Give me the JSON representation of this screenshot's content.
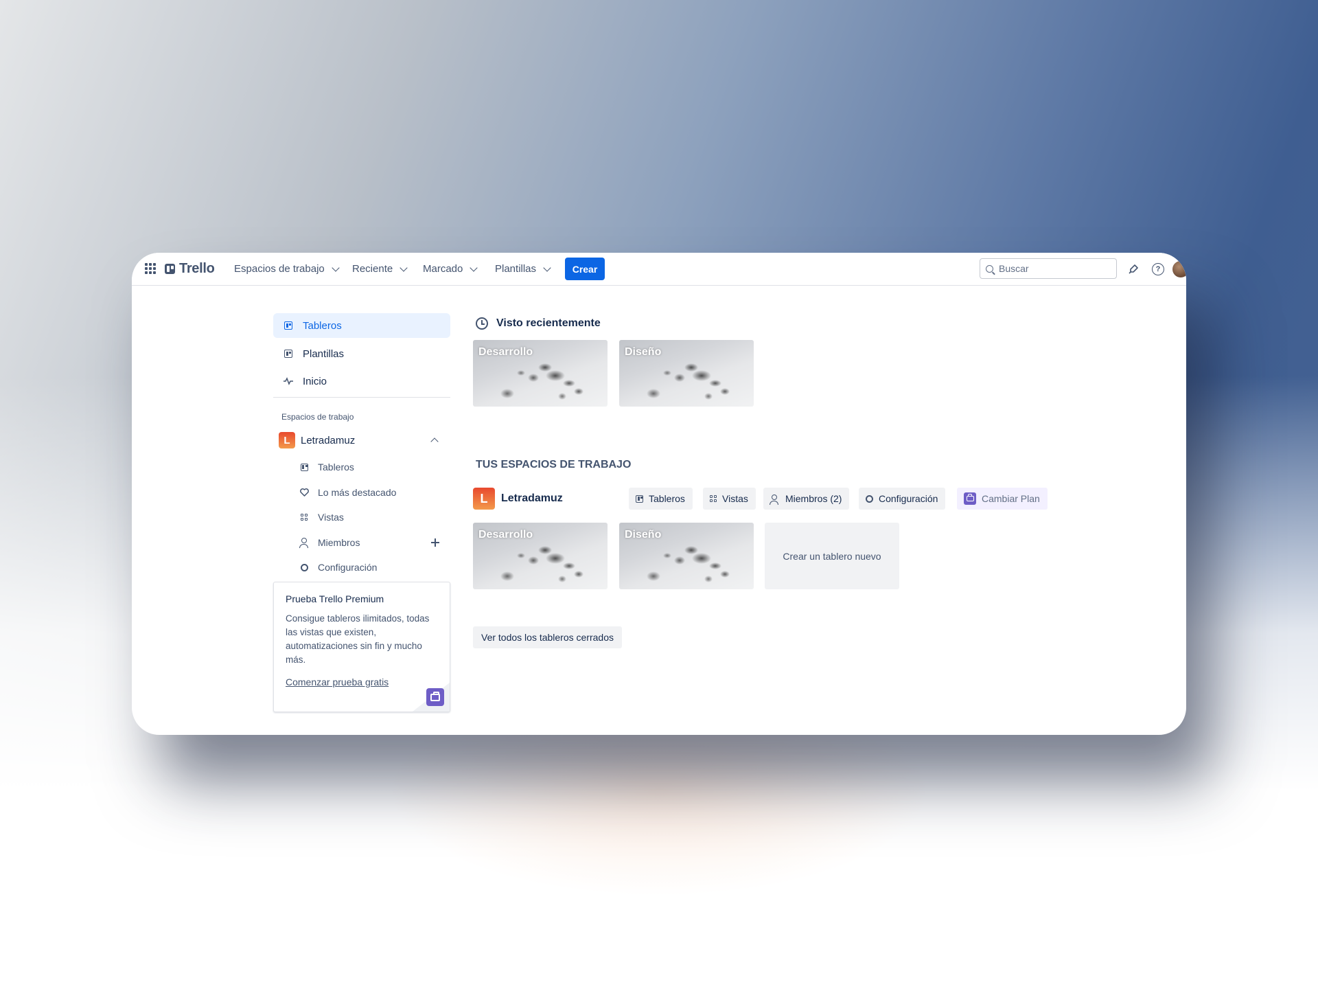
{
  "header": {
    "logo": "Trello",
    "nav": [
      {
        "label": "Espacios de trabajo"
      },
      {
        "label": "Reciente"
      },
      {
        "label": "Marcado"
      },
      {
        "label": "Plantillas"
      }
    ],
    "create_label": "Crear",
    "search_placeholder": "Buscar",
    "icons": [
      "apps-grid-icon",
      "rocket-notification-icon",
      "help-icon",
      "avatar"
    ]
  },
  "sidebar": {
    "items": [
      {
        "label": "Tableros",
        "icon": "board-icon",
        "active": true
      },
      {
        "label": "Plantillas",
        "icon": "template-icon"
      },
      {
        "label": "Inicio",
        "icon": "activity-icon"
      }
    ],
    "workspaces_label": "Espacios de trabajo",
    "workspace": {
      "initial": "L",
      "name": "Letradamuz",
      "subitems": [
        {
          "label": "Tableros",
          "icon": "board-icon"
        },
        {
          "label": "Lo más destacado",
          "icon": "heart-icon"
        },
        {
          "label": "Vistas",
          "icon": "grid-icon"
        },
        {
          "label": "Miembros",
          "icon": "members-icon"
        },
        {
          "label": "Configuración",
          "icon": "gear-icon"
        }
      ]
    },
    "promo": {
      "title": "Prueba Trello Premium",
      "body": "Consigue tableros ilimitados, todas las vistas que existen, automatizaciones sin fin y mucho más.",
      "link": "Comenzar prueba gratis"
    }
  },
  "main": {
    "recent_title": "Visto recientemente",
    "recent_boards": [
      {
        "name": "Desarrollo"
      },
      {
        "name": "Diseño"
      }
    ],
    "workspaces_heading": "TUS ESPACIOS DE TRABAJO",
    "workspace": {
      "initial": "L",
      "name": "Letradamuz",
      "buttons": [
        {
          "label": "Tableros"
        },
        {
          "label": "Vistas"
        },
        {
          "label": "Miembros (2)"
        },
        {
          "label": "Configuración"
        },
        {
          "label": "Cambiar Plan"
        }
      ],
      "boards": [
        {
          "name": "Desarrollo"
        },
        {
          "name": "Diseño"
        }
      ],
      "create_board_label": "Crear un tablero nuevo"
    },
    "closed_boards_label": "Ver todos los tableros cerrados"
  },
  "colors": {
    "accent": "#0c66e4",
    "active_bg": "#e9f2ff",
    "workspace_badge": "#e8492e",
    "premium": "#6e5dc6"
  }
}
